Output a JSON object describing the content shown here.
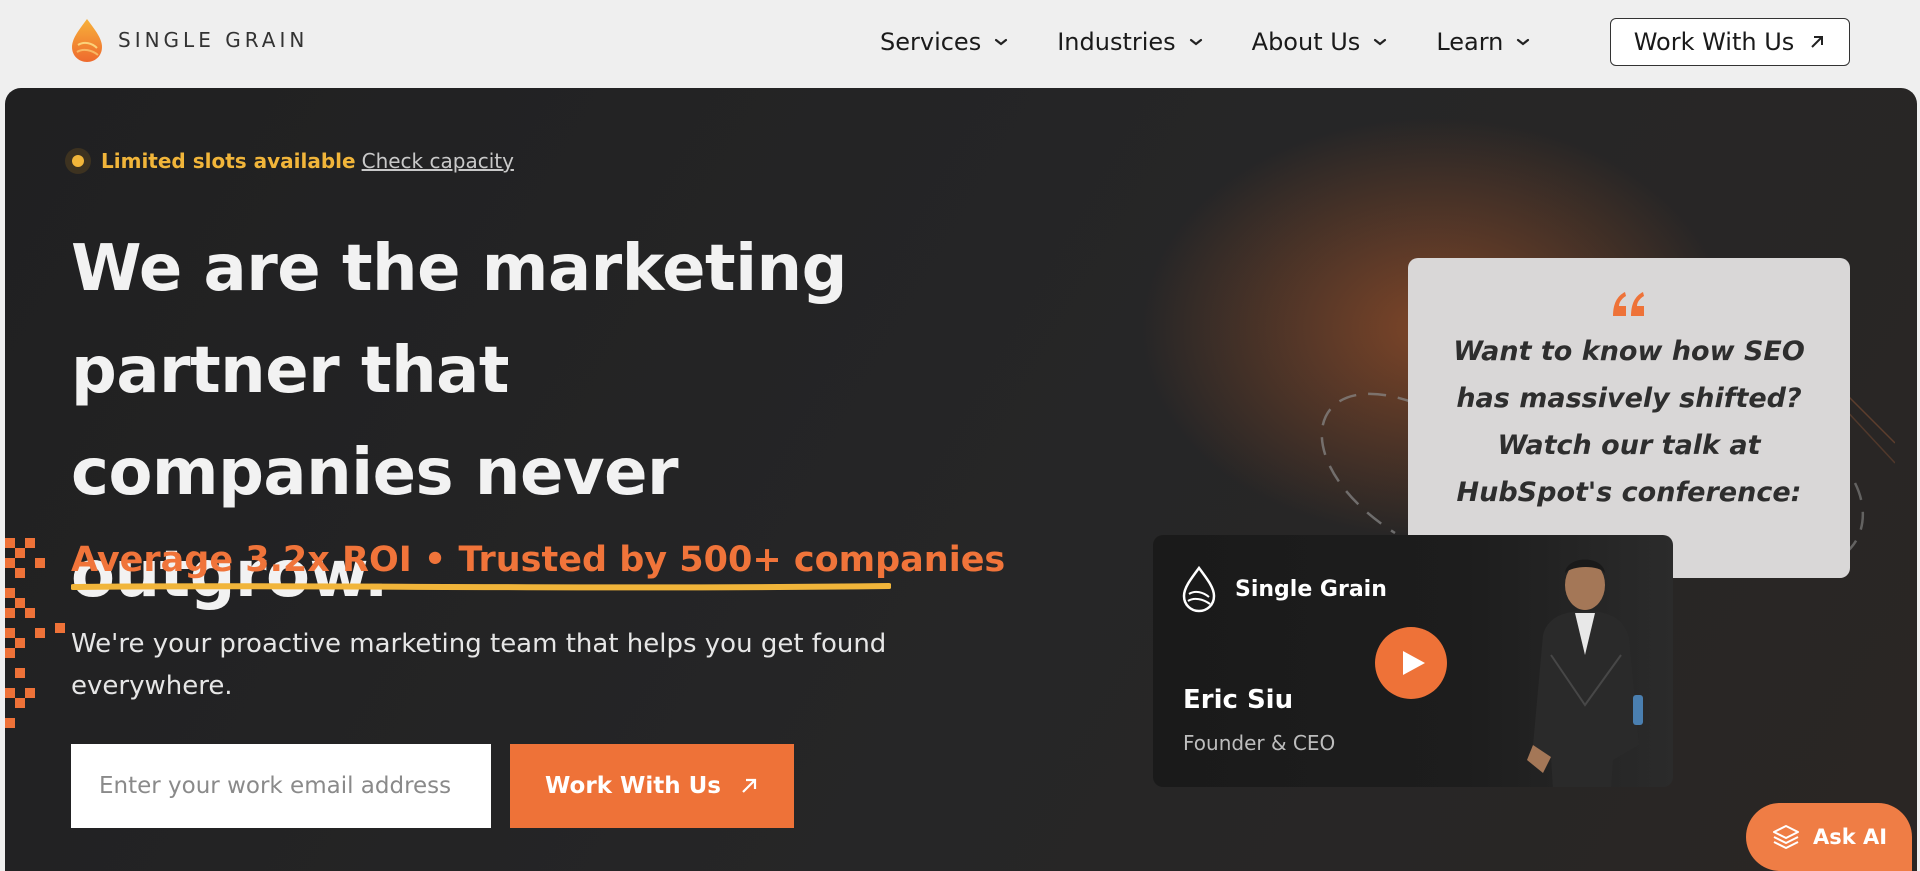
{
  "header": {
    "logo_text": "SINGLE GRAIN",
    "nav": [
      {
        "label": "Services"
      },
      {
        "label": "Industries"
      },
      {
        "label": "About Us"
      },
      {
        "label": "Learn"
      }
    ],
    "cta_label": "Work With Us"
  },
  "hero": {
    "badge_text": "Limited slots available",
    "badge_link": "Check capacity",
    "headline": "We are the marketing partner that companies never outgrow.",
    "roi_line": "Average 3.2x ROI • Trusted by 500+ companies",
    "subtext": "We're your proactive marketing team that helps you get found everywhere.",
    "email_placeholder": "Enter your work email address",
    "cta_label": "Work With Us"
  },
  "quote_card": {
    "text": "Want to know how SEO has massively shifted? Watch our talk at HubSpot's conference:"
  },
  "video_card": {
    "brand": "Single Grain",
    "name": "Eric Siu",
    "role": "Founder & CEO"
  },
  "ask_ai": {
    "label": "Ask AI"
  },
  "colors": {
    "accent_orange": "#ee7238",
    "badge_yellow": "#f1b53a",
    "hero_bg": "#232324",
    "header_bg": "#efefef"
  },
  "icons": [
    "logo-mark",
    "chevron-down-icon",
    "arrow-up-right-icon",
    "quote-icon",
    "play-icon",
    "layers-icon"
  ]
}
